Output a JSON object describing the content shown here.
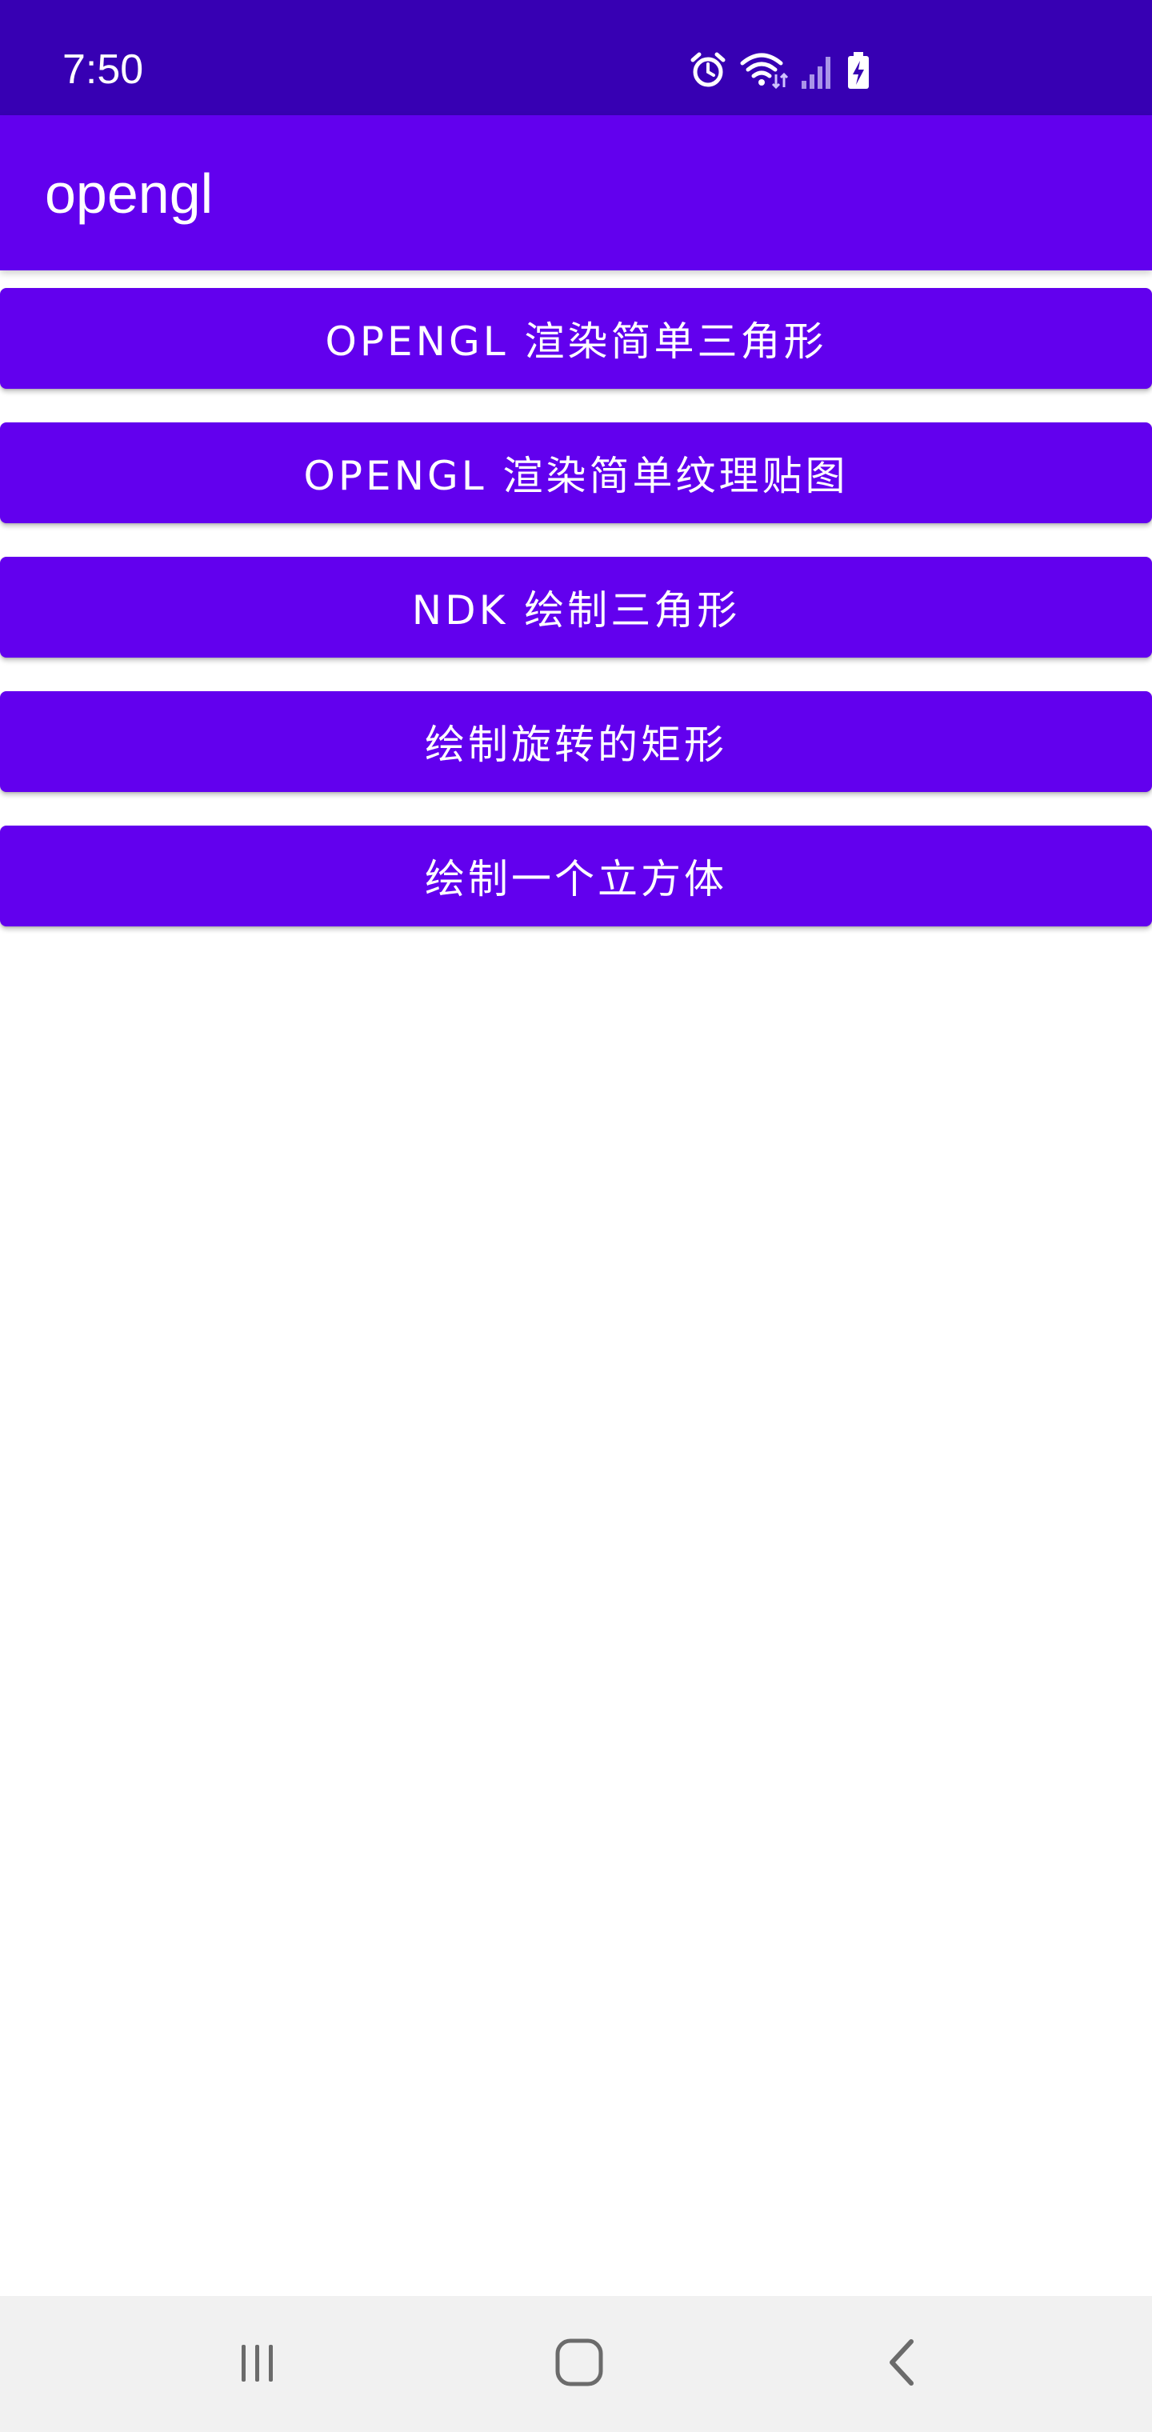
{
  "status_bar": {
    "time": "7:50",
    "icons": [
      "alarm-icon",
      "wifi-icon",
      "signal-icon",
      "battery-charging-icon"
    ]
  },
  "app_bar": {
    "title": "opengl"
  },
  "buttons": [
    {
      "label": "OPENGL 渲染简单三角形"
    },
    {
      "label": "OPENGL 渲染简单纹理贴图"
    },
    {
      "label": "NDK 绘制三角形"
    },
    {
      "label": "绘制旋转的矩形"
    },
    {
      "label": "绘制一个立方体"
    }
  ],
  "nav_bar": {
    "items": [
      "recents-icon",
      "home-icon",
      "back-icon"
    ]
  },
  "colors": {
    "status_bar": "#3700b3",
    "primary": "#6200ee",
    "background": "#ffffff",
    "nav_bar": "#f1f1f1"
  }
}
